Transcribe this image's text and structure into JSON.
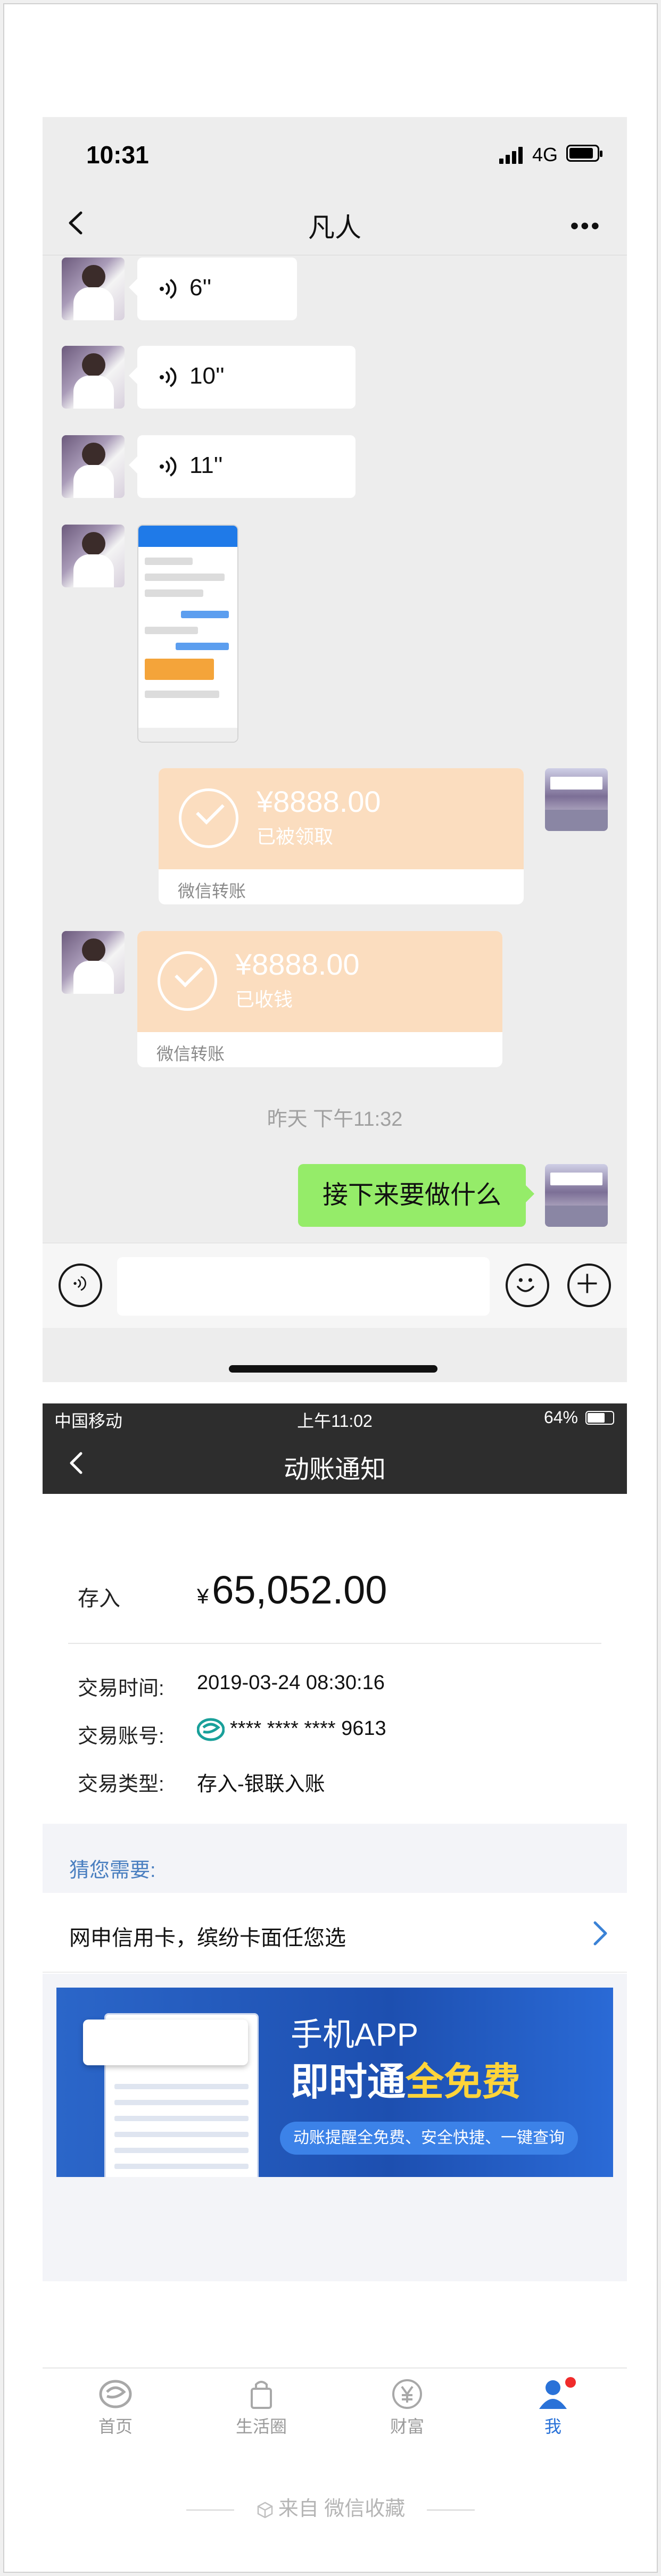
{
  "chat": {
    "status_time": "10:31",
    "network": "4G",
    "title": "凡人",
    "more": "•••",
    "voice_messages": [
      "6''",
      "10''",
      "11''"
    ],
    "transfers": [
      {
        "amount": "¥8888.00",
        "state": "已被领取",
        "label": "微信转账"
      },
      {
        "amount": "¥8888.00",
        "state": "已收钱",
        "label": "微信转账"
      }
    ],
    "timestamp": "昨天 下午11:32",
    "sent_text": "接下来要做什么"
  },
  "bank": {
    "carrier": "中国移动",
    "time": "上午11:02",
    "battery": "64%",
    "title": "动账通知",
    "amount_label": "存入",
    "amount_currency": "¥",
    "amount": "65,052.00",
    "details": [
      {
        "key": "交易时间:",
        "value": "2019-03-24 08:30:16"
      },
      {
        "key": "交易账号:",
        "value": "**** **** **** 9613"
      },
      {
        "key": "交易类型:",
        "value": "存入-银联入账"
      }
    ],
    "guess_title": "猜您需要:",
    "promo_text": "网申信用卡，缤纷卡面任您选",
    "banner": {
      "line1": "手机APP",
      "line2_a": "即时通",
      "line2_b": "全免费",
      "pill": "动账提醒全免费、安全快捷、一键查询"
    },
    "tabs": [
      "首页",
      "生活圈",
      "财富",
      "我"
    ]
  },
  "footer": {
    "text": "来自  微信收藏"
  },
  "colors": {
    "wechat_green": "#95ec69",
    "transfer_orange": "#fbddbf",
    "bank_blue": "#2a72d8"
  }
}
